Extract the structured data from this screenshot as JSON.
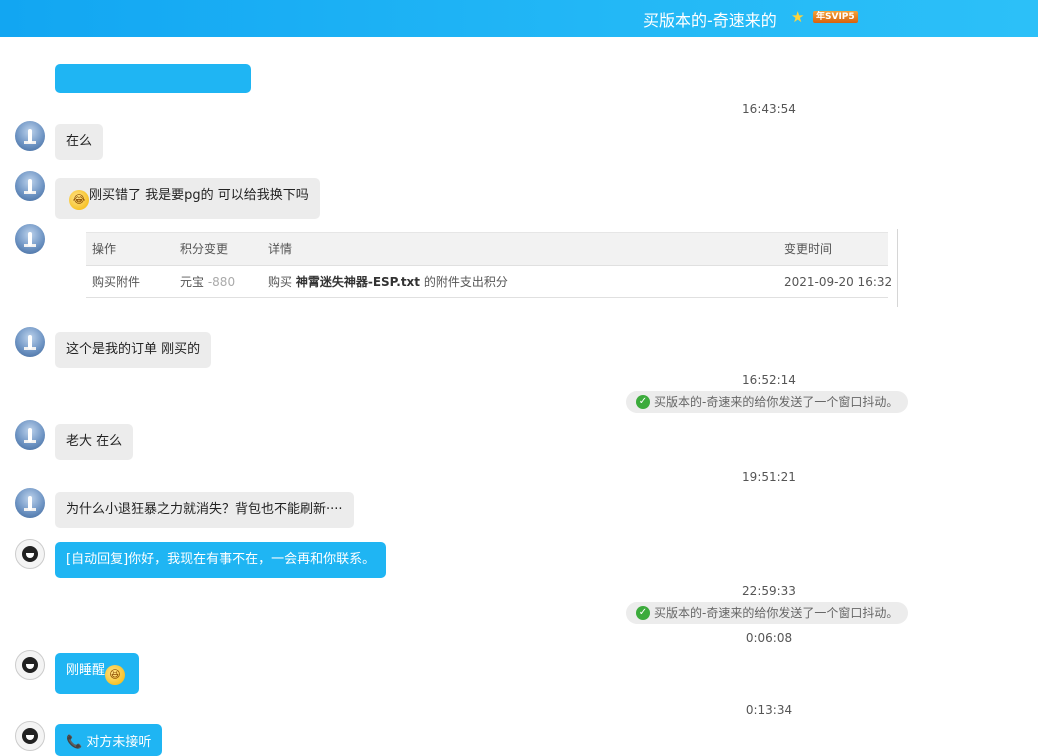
{
  "window": {
    "title": "买版本的-奇速来的",
    "badge": "年SVIP5"
  },
  "timestamps": [
    "16:43:54",
    "16:52:14",
    "19:51:21",
    "22:59:33",
    "0:06:08",
    "0:13:34"
  ],
  "messages": {
    "m1": "在么",
    "m2": "刚买错了 我是要pg的 可以给我换下吗",
    "m3": "这个是我的订单  刚买的",
    "m4": "老大 在么",
    "m5": "为什么小退狂暴之力就消失？背包也不能刷新····",
    "m6": "[自动回复]你好，我现在有事不在，一会再和你联系。",
    "m7": "刚睡醒",
    "m8": "对方未接听"
  },
  "system": {
    "nudge1": "买版本的-奇速来的给你发送了一个窗口抖动。",
    "nudge2": "买版本的-奇速来的给你发送了一个窗口抖动。"
  },
  "order": {
    "headers": [
      "操作",
      "积分变更",
      "详情",
      "变更时间"
    ],
    "row": {
      "action": "购买附件",
      "currency": "元宝",
      "amount": "-880",
      "detail_prefix": "购买",
      "detail_item": "神霄迷失神器-ESP.txt",
      "detail_suffix": "的附件支出积分",
      "time": "2021-09-20 16:32"
    }
  }
}
